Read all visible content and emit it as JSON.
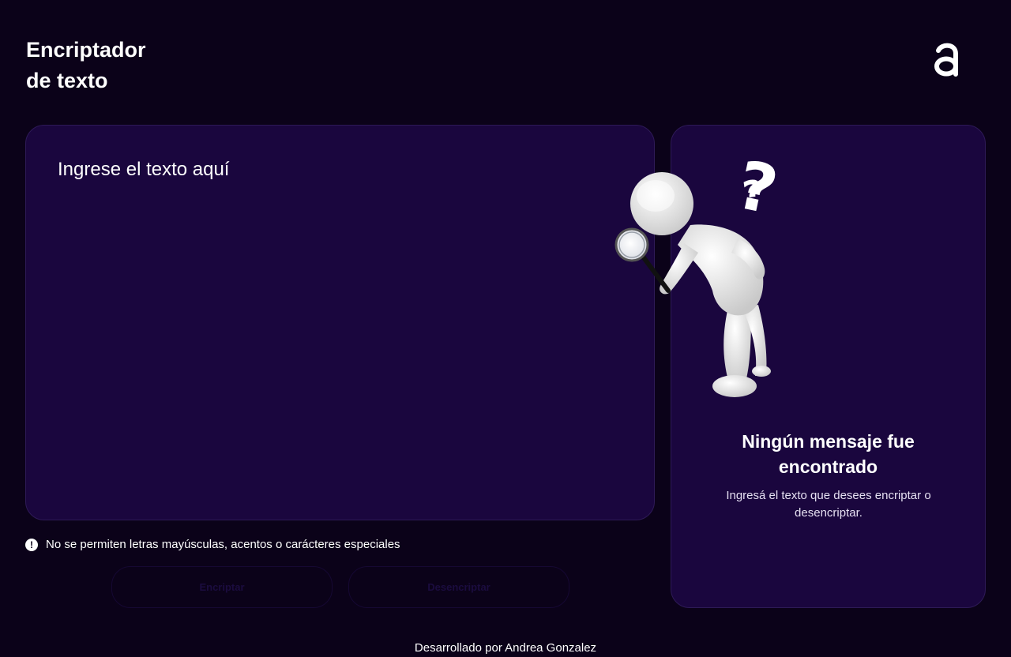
{
  "header": {
    "title_line1": "Encriptador",
    "title_line2": "de texto",
    "logo_icon": "alura-a-logo-icon"
  },
  "input": {
    "placeholder": "Ingrese el texto aquí",
    "value": ""
  },
  "output": {
    "illustration": "figure-with-magnifying-glass-icon",
    "title_line1": "Ningún mensaje fue",
    "title_line2": "encontrado",
    "subtitle": "Ingresá el texto que desees encriptar o desencriptar."
  },
  "warning": {
    "icon": "exclamation-circle-icon",
    "text": "No se permiten letras mayúsculas, acentos o carácteres especiales"
  },
  "buttons": {
    "encrypt_label": "Encriptar",
    "decrypt_label": "Desencriptar"
  },
  "footer": {
    "text": "Desarrollado por Andrea Gonzalez"
  },
  "colors": {
    "background": "#0b0219",
    "panel": "#1a063e",
    "panel_border": "#2e1a57",
    "text": "#ffffff"
  }
}
